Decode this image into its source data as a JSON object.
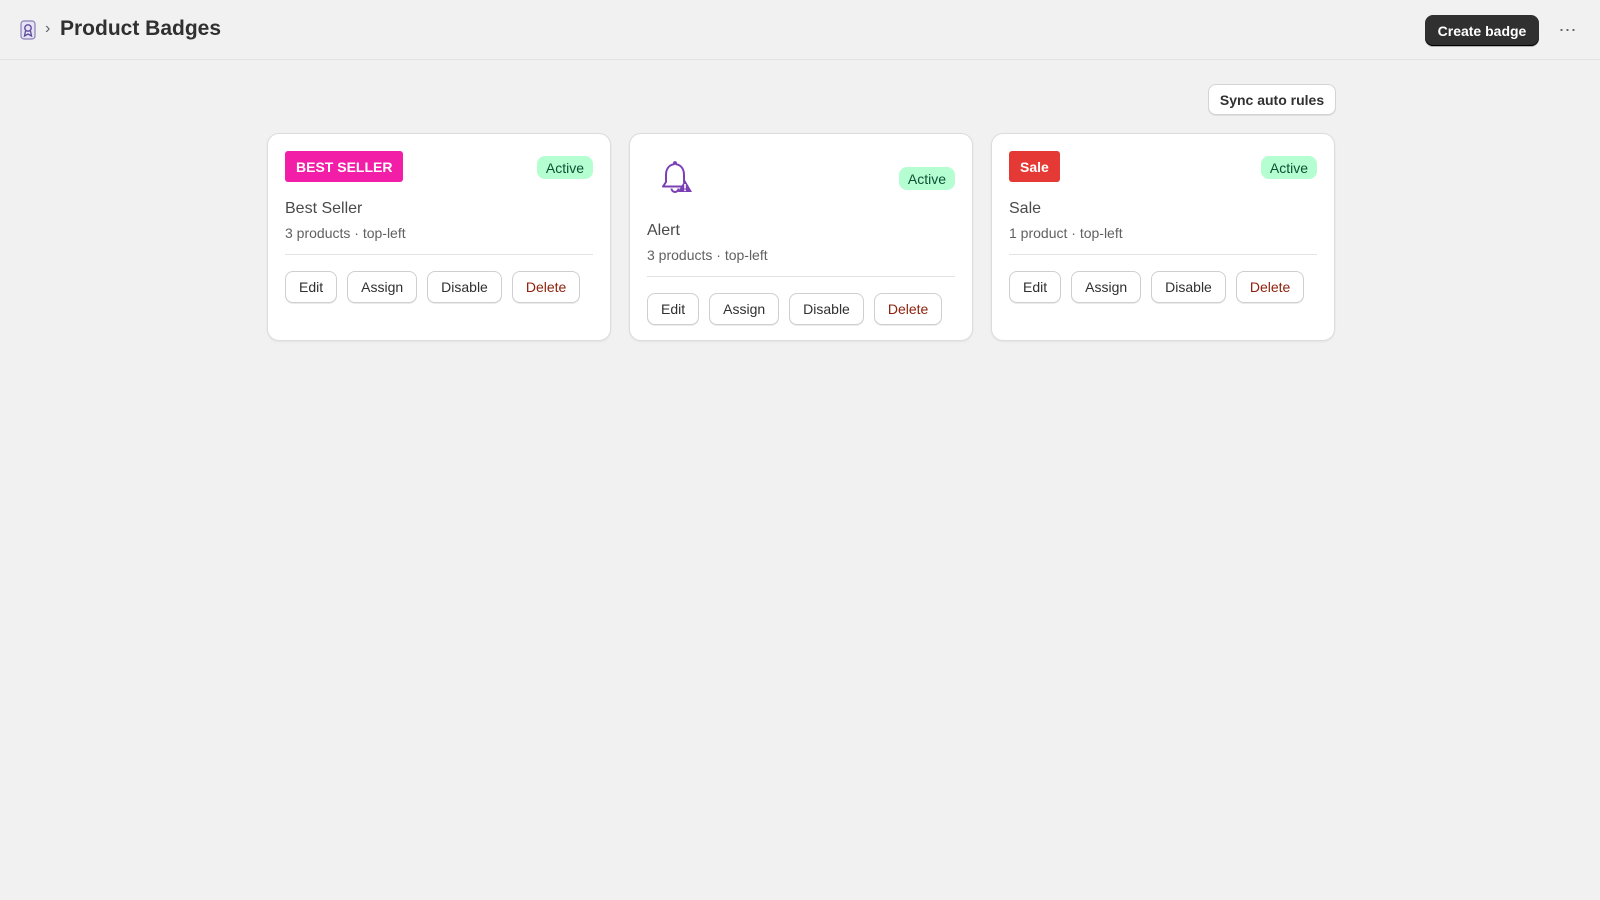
{
  "header": {
    "app_icon": "badge-app-icon",
    "breadcrumb_separator": "›",
    "title": "Product Badges",
    "create_label": "Create badge",
    "more_label": "⋯"
  },
  "toolbar": {
    "sync_label": "Sync auto rules"
  },
  "colors": {
    "best_seller": "#f21ea8",
    "sale": "#e53935",
    "bell": "#7b3fb6",
    "active_bg": "#b4fed2",
    "active_text": "#0c5132",
    "danger": "#8e1f0b"
  },
  "cards": [
    {
      "preview_text": "BEST SELLER",
      "status": "Active",
      "name": "Best Seller",
      "meta": "3 products · top-left",
      "actions": {
        "edit": "Edit",
        "assign": "Assign",
        "disable": "Disable",
        "delete": "Delete"
      }
    },
    {
      "preview_icon": "bell-alert-icon",
      "status": "Active",
      "name": "Alert",
      "meta": "3 products · top-left",
      "actions": {
        "edit": "Edit",
        "assign": "Assign",
        "disable": "Disable",
        "delete": "Delete"
      }
    },
    {
      "preview_text": "Sale",
      "status": "Active",
      "name": "Sale",
      "meta": "1 product · top-left",
      "actions": {
        "edit": "Edit",
        "assign": "Assign",
        "disable": "Disable",
        "delete": "Delete"
      }
    }
  ]
}
